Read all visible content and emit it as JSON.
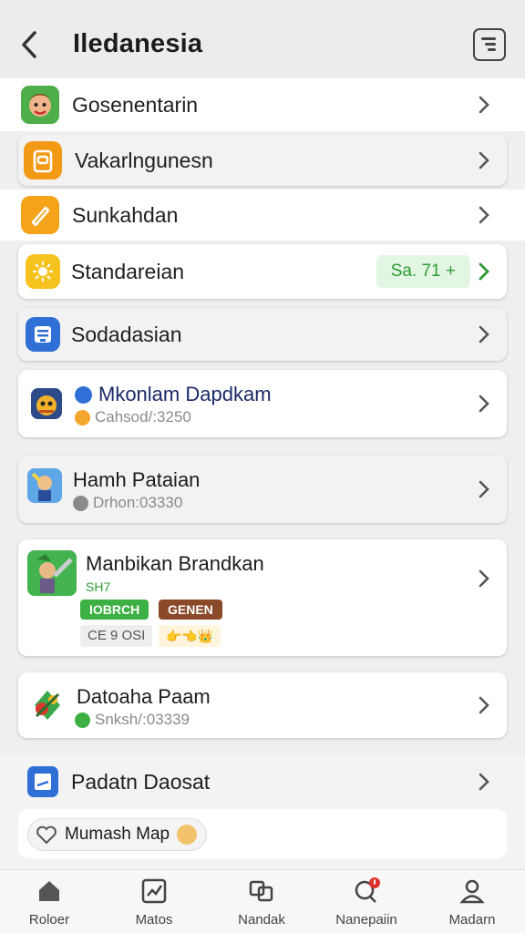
{
  "header": {
    "title": "Iledanesia",
    "back_icon": "chevron-left-icon",
    "action_icon": "document-list-icon"
  },
  "rows": [
    {
      "label": "Gosenentarin"
    },
    {
      "label": "Vakarlngunesn"
    },
    {
      "label": "Sunkahdan"
    },
    {
      "label": "Standareian",
      "badge": "Sa. 71 +"
    },
    {
      "label": "Sodadasian"
    }
  ],
  "games": [
    {
      "title": "Mkonlam Dapdkam",
      "sub": "Cahsod/:3250"
    },
    {
      "title": "Hamh Pataian",
      "sub": "Drhon:03330"
    },
    {
      "title": "Manbikan Brandkan",
      "subtitle": "SH7",
      "tag_green": "IOBRCH",
      "tag_brown": "GENEN",
      "tag_plain": "CE 9 OSI",
      "tag_emoji": "👉👈👑"
    },
    {
      "title": "Datoaha Paam",
      "sub": "Snksh/:03339"
    }
  ],
  "bottom_item": {
    "label": "Padatn Daosat"
  },
  "chip": {
    "label": "Mumash Map"
  },
  "nav": [
    {
      "label": "Roloer",
      "icon": "home-icon"
    },
    {
      "label": "Matos",
      "icon": "chart-icon"
    },
    {
      "label": "Nandak",
      "icon": "windows-icon"
    },
    {
      "label": "Nanepaiin",
      "icon": "search-notification-icon"
    },
    {
      "label": "Madarn",
      "icon": "profile-icon"
    }
  ],
  "colors": {
    "accent_green": "#2f9b34",
    "badge_bg": "#e3f6e3",
    "orange": "#f29a15",
    "blue": "#2f6fd6"
  }
}
